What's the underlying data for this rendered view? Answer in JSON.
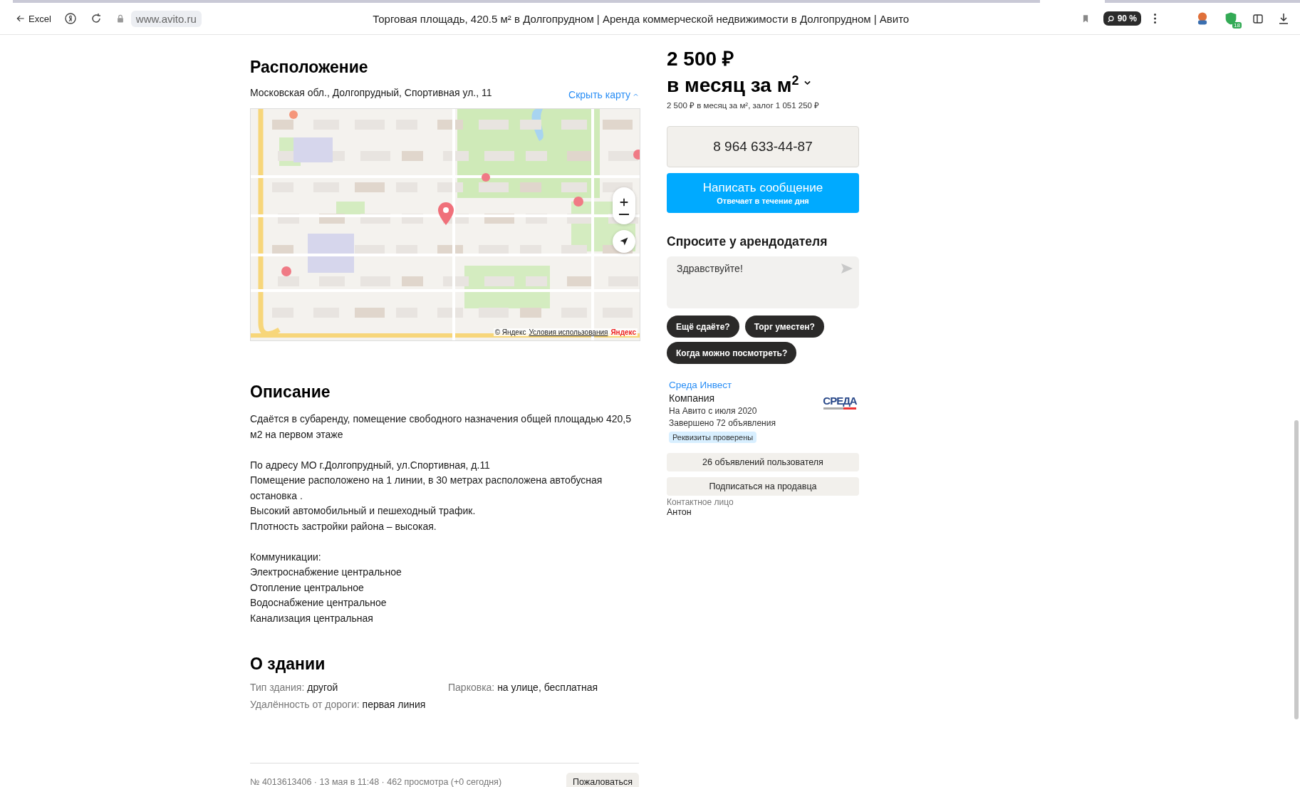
{
  "browser": {
    "back_label": "Excel",
    "url": "www.avito.ru",
    "title": "Торговая площадь, 420.5 м² в Долгопрудном | Аренда коммерческой недвижимости в Долгопрудном | Авито",
    "zoom": "90 %",
    "extension_badge": "18"
  },
  "location": {
    "heading": "Расположение",
    "address": "Московская обл., Долгопрудный, Спортивная ул., 11",
    "hide_map": "Скрыть карту",
    "map": {
      "attribution": "© Яндекс",
      "terms": "Условия использования",
      "logo": "Яндекс"
    }
  },
  "description": {
    "heading": "Описание",
    "paragraphs": [
      [
        "Сдаётся в субаренду, помещение свободного назначения общей площадью 420,5 м2 на первом этаже"
      ],
      [
        "По адресу МО г.Долгопрудный, ул.Спортивная, д.11",
        "Помещение расположено на 1 линии, в 30 метрах расположена автобусная остановка .",
        "Высокий автомобильный и пешеходный трафик.",
        "Плотность застройки района – высокая."
      ],
      [
        "Коммуникации:",
        "Электроснабжение центральное",
        "Отопление центральное",
        "Водоснабжение центральное",
        "Канализация центральная"
      ]
    ]
  },
  "building": {
    "heading": "О здании",
    "params": [
      {
        "label": "Тип здания:",
        "value": "другой"
      },
      {
        "label": "Парковка:",
        "value": "на улице, бесплатная"
      },
      {
        "label": "Удалённость от дороги:",
        "value": "первая линия"
      }
    ]
  },
  "footer": {
    "meta": "№ 4013613406 · 13 мая в 11:48 · 462 просмотра (+0 сегодня)",
    "report": "Пожаловаться"
  },
  "price": {
    "amount": "2 500 ₽",
    "unit": "в месяц за м$^{2}$",
    "details": "2 500 ₽ в месяц за м², залог 1 051 250 ₽"
  },
  "phone": "8 964 633-44-87",
  "message_button": {
    "label": "Написать сообщение",
    "sublabel": "Отвечает в течение дня"
  },
  "ask": {
    "heading": "Спросите у арендодателя",
    "value": "Здравствуйте!",
    "chips": [
      "Ещё сдаёте?",
      "Торг уместен?",
      "Когда можно посмотреть?"
    ]
  },
  "seller": {
    "name": "Среда Инвест",
    "type": "Компания",
    "since": "На Авито с июля 2020",
    "completed": "Завершено 72 объявления",
    "badge": "Реквизиты проверены",
    "logo": "СРЕДА"
  },
  "seller_buttons": [
    "26 объявлений пользователя",
    "Подписаться на продавца"
  ],
  "contact": {
    "label": "Контактное лицо",
    "name": "Антон"
  }
}
